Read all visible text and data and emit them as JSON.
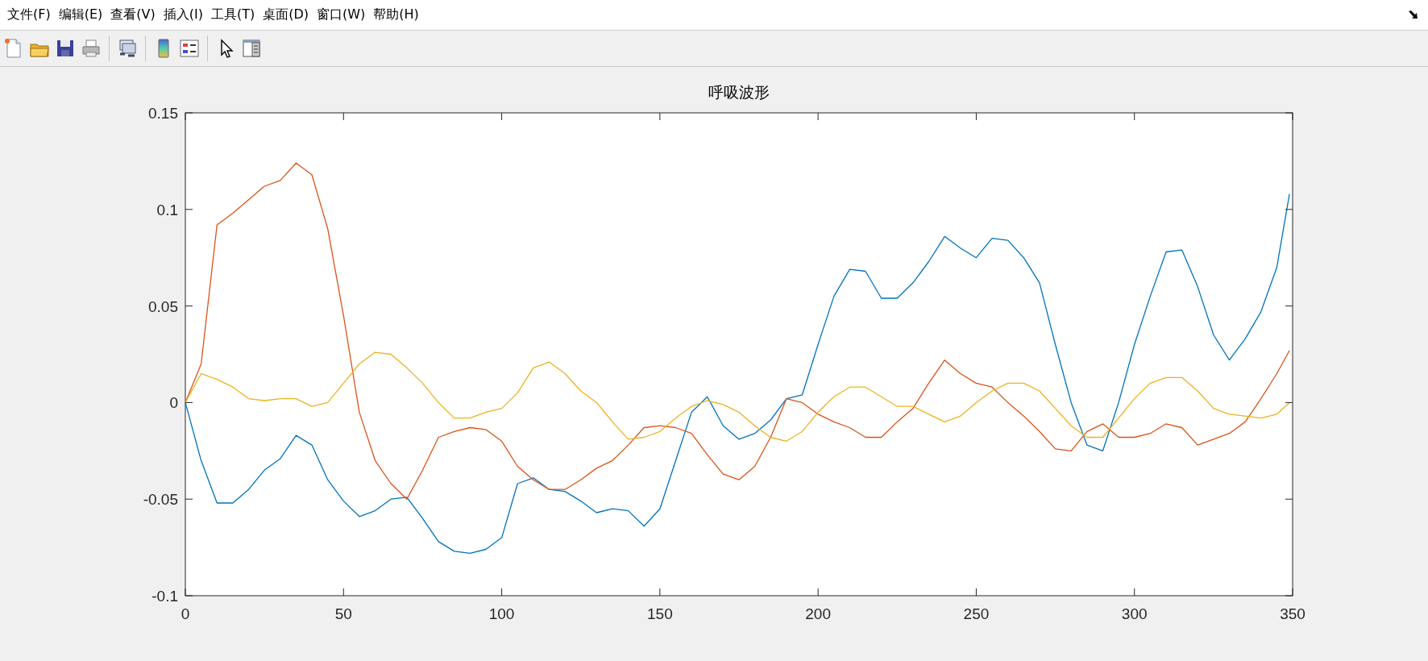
{
  "menu": [
    "文件(F)",
    "编辑(E)",
    "查看(V)",
    "插入(I)",
    "工具(T)",
    "桌面(D)",
    "窗口(W)",
    "帮助(H)"
  ],
  "figure": {
    "chart_data": {
      "type": "line",
      "title": "呼吸波形",
      "x": [
        0,
        5,
        10,
        15,
        20,
        25,
        30,
        35,
        40,
        45,
        50,
        55,
        60,
        65,
        70,
        75,
        80,
        85,
        90,
        95,
        100,
        105,
        110,
        115,
        120,
        125,
        130,
        135,
        140,
        145,
        150,
        155,
        160,
        165,
        170,
        175,
        180,
        185,
        190,
        195,
        200,
        205,
        210,
        215,
        220,
        225,
        230,
        235,
        240,
        245,
        250,
        255,
        260,
        265,
        270,
        275,
        280,
        285,
        290,
        295,
        300,
        305,
        310,
        315,
        320,
        325,
        330,
        335,
        340,
        345,
        349
      ],
      "xlim": [
        0,
        350
      ],
      "ylim": [
        -0.1,
        0.15
      ],
      "xticks": [
        0,
        50,
        100,
        150,
        200,
        250,
        300,
        350
      ],
      "yticks": [
        -0.1,
        -0.05,
        0,
        0.05,
        0.1,
        0.15
      ],
      "series": [
        {
          "color": "#0072bd",
          "values": [
            0,
            -0.03,
            -0.052,
            -0.052,
            -0.045,
            -0.035,
            -0.029,
            -0.017,
            -0.022,
            -0.04,
            -0.051,
            -0.059,
            -0.056,
            -0.05,
            -0.049,
            -0.06,
            -0.072,
            -0.077,
            -0.078,
            -0.076,
            -0.07,
            -0.042,
            -0.039,
            -0.045,
            -0.046,
            -0.051,
            -0.057,
            -0.055,
            -0.056,
            -0.064,
            -0.055,
            -0.03,
            -0.005,
            0.003,
            -0.012,
            -0.019,
            -0.016,
            -0.009,
            0.002,
            0.004,
            0.03,
            0.055,
            0.069,
            0.068,
            0.054,
            0.054,
            0.062,
            0.073,
            0.086,
            0.08,
            0.075,
            0.085,
            0.084,
            0.075,
            0.062,
            0.03,
            0,
            -0.022,
            -0.025,
            0,
            0.03,
            0.055,
            0.078,
            0.079,
            0.06,
            0.035,
            0.022,
            0.033,
            0.047,
            0.07,
            0.108
          ]
        },
        {
          "color": "#d95319",
          "values": [
            0,
            0.02,
            0.092,
            0.098,
            0.105,
            0.112,
            0.115,
            0.124,
            0.118,
            0.09,
            0.045,
            -0.005,
            -0.03,
            -0.042,
            -0.05,
            -0.035,
            -0.018,
            -0.015,
            -0.013,
            -0.014,
            -0.02,
            -0.033,
            -0.04,
            -0.045,
            -0.045,
            -0.04,
            -0.034,
            -0.03,
            -0.022,
            -0.013,
            -0.012,
            -0.013,
            -0.016,
            -0.027,
            -0.037,
            -0.04,
            -0.033,
            -0.018,
            0.002,
            0,
            -0.006,
            -0.01,
            -0.013,
            -0.018,
            -0.018,
            -0.01,
            -0.003,
            0.01,
            0.022,
            0.015,
            0.01,
            0.008,
            0,
            -0.007,
            -0.015,
            -0.024,
            -0.025,
            -0.015,
            -0.011,
            -0.018,
            -0.018,
            -0.016,
            -0.011,
            -0.013,
            -0.022,
            -0.019,
            -0.016,
            -0.01,
            0.002,
            0.015,
            0.027
          ]
        },
        {
          "color": "#edb120",
          "values": [
            0,
            0.015,
            0.012,
            0.008,
            0.002,
            0.001,
            0.002,
            0.002,
            -0.002,
            0,
            0.01,
            0.02,
            0.026,
            0.025,
            0.018,
            0.01,
            0,
            -0.008,
            -0.008,
            -0.005,
            -0.003,
            0.005,
            0.018,
            0.021,
            0.015,
            0.006,
            0,
            -0.01,
            -0.019,
            -0.018,
            -0.015,
            -0.008,
            -0.002,
            0.001,
            -0.001,
            -0.005,
            -0.012,
            -0.018,
            -0.02,
            -0.015,
            -0.005,
            0.003,
            0.008,
            0.008,
            0.003,
            -0.002,
            -0.002,
            -0.006,
            -0.01,
            -0.007,
            0,
            0.006,
            0.01,
            0.01,
            0.006,
            -0.003,
            -0.012,
            -0.018,
            -0.018,
            -0.008,
            0.002,
            0.01,
            0.013,
            0.013,
            0.006,
            -0.003,
            -0.006,
            -0.007,
            -0.008,
            -0.006,
            0
          ]
        }
      ]
    }
  }
}
